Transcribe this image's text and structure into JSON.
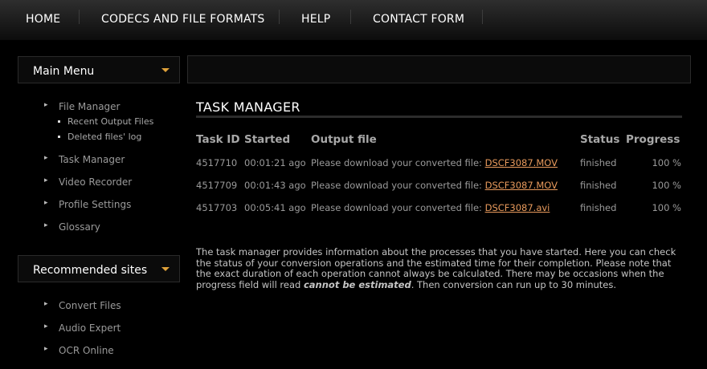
{
  "nav": {
    "home": "HOME",
    "codecs": "CODECS AND FILE FORMATS",
    "help": "HELP",
    "contact": "CONTACT FORM"
  },
  "sidebar": {
    "main_menu": {
      "label": "Main Menu",
      "items": [
        {
          "label": "File Manager"
        },
        {
          "label": "Task Manager"
        },
        {
          "label": "Video Recorder"
        },
        {
          "label": "Profile Settings"
        },
        {
          "label": "Glossary"
        }
      ],
      "file_manager_sub": [
        "Recent Output Files",
        "Deleted files' log"
      ]
    },
    "recommended": {
      "label": "Recommended sites",
      "items": [
        {
          "label": "Convert Files"
        },
        {
          "label": "Audio Expert"
        },
        {
          "label": "OCR Online"
        }
      ]
    }
  },
  "main": {
    "title": "TASK MANAGER",
    "columns": [
      "Task ID",
      "Started",
      "Output file",
      "Status",
      "Progress"
    ],
    "tasks": [
      {
        "id": "4517710",
        "started": "00:01:21 ago",
        "output_prefix": "Please download your converted file:",
        "file": "DSCF3087.MOV",
        "status": "finished",
        "progress": "100 %"
      },
      {
        "id": "4517709",
        "started": "00:01:43 ago",
        "output_prefix": "Please download your converted file:",
        "file": "DSCF3087.MOV",
        "status": "finished",
        "progress": "100 %"
      },
      {
        "id": "4517703",
        "started": "00:05:41 ago",
        "output_prefix": "Please download your converted file:",
        "file": "DSCF3087.avi",
        "status": "finished",
        "progress": "100 %"
      }
    ],
    "description": {
      "part1": "The task manager provides information about the processes that you have started. Here you can check the status of your conversion operations and the estimated time for their completion. Please note that the exact duration of each operation cannot always be calculated. There may be occasions when the progress field will read ",
      "emphasis": "cannot be estimated",
      "part2": ". Then conversion can run up to 30 minutes."
    }
  },
  "colors": {
    "accent_arrow": "#e0a23a",
    "link": "#e89a5c",
    "background": "#000000"
  }
}
